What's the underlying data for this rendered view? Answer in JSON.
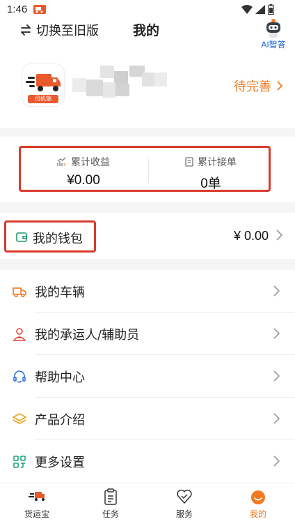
{
  "status_bar": {
    "time": "1:46"
  },
  "header": {
    "switch_label": "切换至旧版",
    "title": "我的",
    "ai_label": "AI智答"
  },
  "profile": {
    "avatar_tag": "司机端",
    "pending_label": "待完善"
  },
  "stats": {
    "income_label": "累计收益",
    "income_value": "¥0.00",
    "orders_label": "累计接单",
    "orders_value": "0单"
  },
  "wallet": {
    "label": "我的钱包",
    "amount": "¥ 0.00"
  },
  "menu": {
    "items": [
      {
        "label": "我的车辆",
        "icon": "truck-icon"
      },
      {
        "label": "我的承运人/辅助员",
        "icon": "person-icon"
      },
      {
        "label": "帮助中心",
        "icon": "headset-icon"
      },
      {
        "label": "产品介绍",
        "icon": "layers-icon"
      },
      {
        "label": "更多设置",
        "icon": "grid-icon"
      }
    ]
  },
  "tabbar": {
    "tabs": [
      {
        "label": "货运宝"
      },
      {
        "label": "任务"
      },
      {
        "label": "服务"
      },
      {
        "label": "我的",
        "active": true
      }
    ]
  },
  "colors": {
    "accent": "#f07a1f",
    "highlight_border": "#d93a2b",
    "ai_blue": "#1a63d9",
    "wallet_green": "#1a9a6e"
  }
}
